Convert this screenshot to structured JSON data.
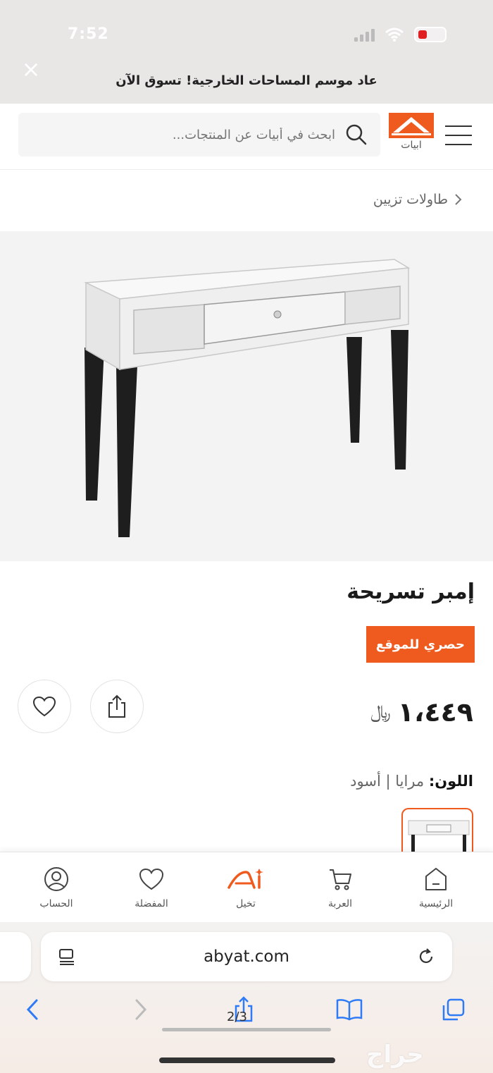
{
  "status_bar": {
    "time": "7:52"
  },
  "promo": {
    "text": "عاد موسم المساحات الخارجية! تسوق الآن",
    "close": "×"
  },
  "header": {
    "search_placeholder": "ابحث في أبيات عن المنتجات...",
    "logo_text": "ابيات"
  },
  "breadcrumb": {
    "label": "طاولات تزيين"
  },
  "product": {
    "title": "إمبر تسريحة",
    "badge": "حصري للموقع",
    "price": "١،٤٤٩",
    "currency": "﷼",
    "color_label": "اللون:",
    "color_value": "مرايا | أسود"
  },
  "bottom_nav": {
    "items": [
      {
        "label": "الرئيسية",
        "icon": "home-icon"
      },
      {
        "label": "العربة",
        "icon": "cart-icon"
      },
      {
        "label": "تخيل",
        "icon": "ai-icon"
      },
      {
        "label": "المفضلة",
        "icon": "heart-icon"
      },
      {
        "label": "الحساب",
        "icon": "account-icon"
      }
    ]
  },
  "safari": {
    "url": "abyat.com",
    "page_count": "2/3"
  },
  "watermark": "حراج",
  "colors": {
    "accent": "#ef5a1f",
    "promo_bg": "#e9e7e6",
    "image_bg": "#f3f3f3",
    "safari_blue": "#2f7bf6"
  }
}
